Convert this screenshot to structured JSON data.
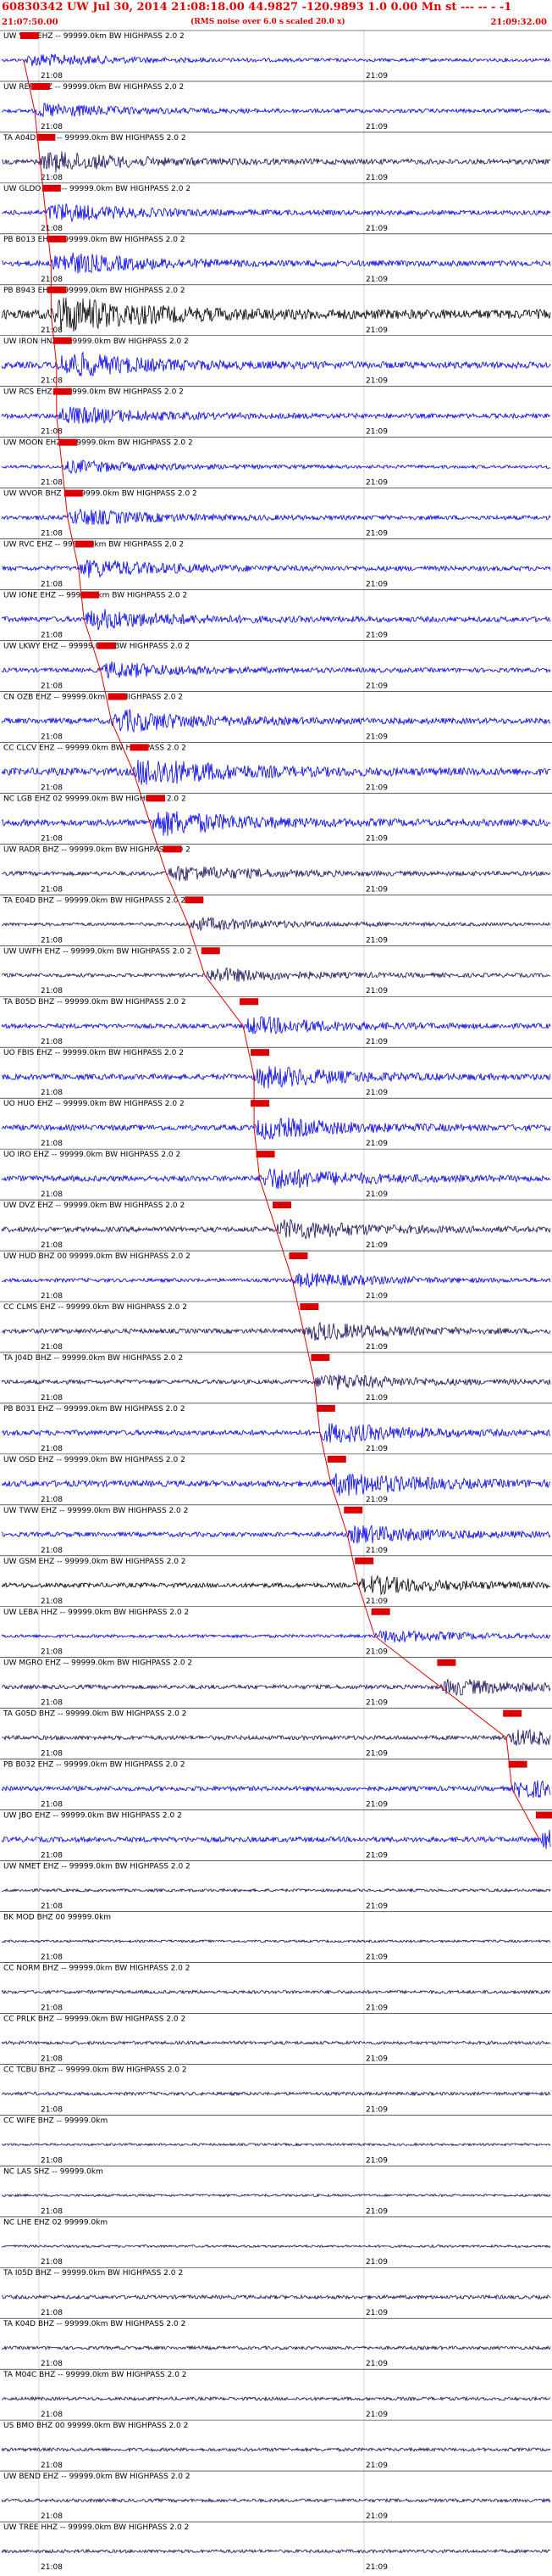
{
  "header": {
    "title": "60830342 UW Jul 30, 2014 21:08:18.00   44.9827 -120.9893  1.0 0.00 Mn st --- -- -   -1",
    "start_time": "21:07:50.00",
    "end_time": "21:09:32.00",
    "note": "(RMS noise over 6.0 s scaled 20.0 x)"
  },
  "colors": {
    "trace_a": "#0000ee",
    "trace_b": "#000000",
    "trace_c": "#1a0d5c",
    "pick": "#dd0000",
    "grid": "#000000",
    "label": "#000000"
  },
  "chart_data": {
    "type": "seismogram",
    "time_range": [
      "21:07:50.00",
      "21:09:32.00"
    ],
    "minute_ticks": [
      "21:08",
      "21:09"
    ],
    "traces": [
      {
        "label": "UW VCR EHZ -- 99999.0km BW  HIGHPASS  2.0  2",
        "color": "#0000ee",
        "amp": 0.35,
        "pick": 0.04
      },
      {
        "label": "UW RER EHZ -- 99999.0km BW  HIGHPASS  2.0  2",
        "color": "#0000ee",
        "amp": 0.4,
        "pick": 0.06
      },
      {
        "label": "TA A04D BHZ -- 99999.0km BW  HIGHPASS  2.0  2",
        "color": "#1a0d5c",
        "amp": 0.55,
        "pick": 0.07
      },
      {
        "label": "UW GLDO EHZ -- 99999.0km BW  HIGHPASS  2.0  2",
        "color": "#0000ee",
        "amp": 0.5,
        "pick": 0.08
      },
      {
        "label": "PB B013 EHZ -- 99999.0km BW  HIGHPASS  2.0  2",
        "color": "#0000ee",
        "amp": 0.6,
        "pick": 0.09
      },
      {
        "label": "PB B943 EHZ -- 99999.0km BW  HIGHPASS  2.0  2",
        "color": "#000000",
        "amp": 1.0,
        "pick": 0.09
      },
      {
        "label": "UW IRON HNZ -- 99999.0km BW  HIGHPASS  2.0  2",
        "color": "#0000ee",
        "amp": 0.7,
        "pick": 0.1
      },
      {
        "label": "UW RCS EHZ -- 99999.0km BW  HIGHPASS  2.0  2",
        "color": "#0000ee",
        "amp": 0.5,
        "pick": 0.1
      },
      {
        "label": "UW MOON EHZ -- 99999.0km BW  HIGHPASS  2.0  2",
        "color": "#0000ee",
        "amp": 0.35,
        "pick": 0.11
      },
      {
        "label": "UW WVOR BHZ 00 99999.0km BW  HIGHPASS  2.0  2",
        "color": "#0000ee",
        "amp": 0.45,
        "pick": 0.12
      },
      {
        "label": "UW RVC EHZ -- 99999.0km BW  HIGHPASS  2.0  2",
        "color": "#0000ee",
        "amp": 0.5,
        "pick": 0.14
      },
      {
        "label": "UW IONE EHZ -- 99999.0km BW  HIGHPASS  2.0  2",
        "color": "#0000ee",
        "amp": 0.55,
        "pick": 0.15
      },
      {
        "label": "UW LKWY EHZ -- 99999.0km BW  HIGHPASS  2.0  2",
        "color": "#0000ee",
        "amp": 0.45,
        "pick": 0.18
      },
      {
        "label": "CN OZB EHZ -- 99999.0km BW  HIGHPASS  2.0  2",
        "color": "#0000ee",
        "amp": 0.6,
        "pick": 0.2
      },
      {
        "label": "CC CLCV EHZ -- 99999.0km BW  HIGHPASS  2.0  2",
        "color": "#0000ee",
        "amp": 0.8,
        "pick": 0.24
      },
      {
        "label": "NC LGB EHZ 02 99999.0km BW  HIGHPASS  2.0  2",
        "color": "#0000ee",
        "amp": 0.7,
        "pick": 0.27
      },
      {
        "label": "UW RADR BHZ -- 99999.0km BW  HIGHPASS  2.0  2",
        "color": "#1a0d5c",
        "amp": 0.45,
        "pick": 0.3
      },
      {
        "label": "TA E04D BHZ -- 99999.0km BW  HIGHPASS  2.0  2",
        "color": "#1a0d5c",
        "amp": 0.35,
        "pick": 0.34
      },
      {
        "label": "UW UWFH EHZ -- 99999.0km BW  HIGHPASS  2.0  2",
        "color": "#1a0d5c",
        "amp": 0.4,
        "pick": 0.37
      },
      {
        "label": "TA B05D BHZ -- 99999.0km BW  HIGHPASS  2.0  2",
        "color": "#0000ee",
        "amp": 0.5,
        "pick": 0.44
      },
      {
        "label": "UO FBIS EHZ -- 99999.0km BW  HIGHPASS  2.0  2",
        "color": "#0000ee",
        "amp": 0.6,
        "pick": 0.46
      },
      {
        "label": "UO HUO EHZ -- 99999.0km BW  HIGHPASS  2.0  2",
        "color": "#0000ee",
        "amp": 0.6,
        "pick": 0.46
      },
      {
        "label": "UO IRO EHZ -- 99999.0km BW  HIGHPASS  2.0  2",
        "color": "#0000ee",
        "amp": 0.6,
        "pick": 0.47
      },
      {
        "label": "UW DVZ EHZ -- 99999.0km BW  HIGHPASS  2.0  2",
        "color": "#1a0d5c",
        "amp": 0.55,
        "pick": 0.5
      },
      {
        "label": "UW HUD BHZ 00 99999.0km BW  HIGHPASS  2.0  2",
        "color": "#0000ee",
        "amp": 0.4,
        "pick": 0.53
      },
      {
        "label": "CC CLMS EHZ -- 99999.0km BW  HIGHPASS  2.0  2",
        "color": "#1a0d5c",
        "amp": 0.5,
        "pick": 0.55
      },
      {
        "label": "TA J04D BHZ -- 99999.0km BW  HIGHPASS  2.0  2",
        "color": "#1a0d5c",
        "amp": 0.45,
        "pick": 0.57
      },
      {
        "label": "PB B031 EHZ -- 99999.0km BW  HIGHPASS  2.0  2",
        "color": "#0000ee",
        "amp": 0.55,
        "pick": 0.58
      },
      {
        "label": "UW OSD EHZ -- 99999.0km BW  HIGHPASS  2.0  2",
        "color": "#0000ee",
        "amp": 0.65,
        "pick": 0.6
      },
      {
        "label": "UW TWW EHZ -- 99999.0km BW  HIGHPASS  2.0  2",
        "color": "#0000ee",
        "amp": 0.5,
        "pick": 0.63
      },
      {
        "label": "UW GSM EHZ -- 99999.0km BW  HIGHPASS  2.0  2",
        "color": "#000000",
        "amp": 0.5,
        "pick": 0.65
      },
      {
        "label": "UW LEBA HHZ -- 99999.0km BW  HIGHPASS  2.0  2",
        "color": "#0000ee",
        "amp": 0.35,
        "pick": 0.68
      },
      {
        "label": "UW MGRO EHZ -- 99999.0km BW  HIGHPASS  2.0  2",
        "color": "#1a0d5c",
        "amp": 0.45,
        "pick": 0.8
      },
      {
        "label": "TA G05D BHZ -- 99999.0km BW  HIGHPASS  2.0  2",
        "color": "#1a0d5c",
        "amp": 0.45,
        "pick": 0.92
      },
      {
        "label": "PB B032 EHZ -- 99999.0km BW  HIGHPASS  2.0  2",
        "color": "#0000ee",
        "amp": 0.5,
        "pick": 0.93
      },
      {
        "label": "UW JBO EHZ -- 99999.0km BW  HIGHPASS  2.0  2",
        "color": "#0000ee",
        "amp": 0.55,
        "pick": 0.98
      },
      {
        "label": "UW NMET EHZ -- 99999.0km BW  HIGHPASS  2.0  2",
        "color": "#1a0d5c",
        "amp": 0.3,
        "pick": null
      },
      {
        "label": "BK MOD BHZ 00 99999.0km",
        "color": "#1a0d5c",
        "amp": 0.25,
        "pick": null
      },
      {
        "label": "CC NORM BHZ -- 99999.0km BW  HIGHPASS  2.0  2",
        "color": "#1a0d5c",
        "amp": 0.35,
        "pick": null
      },
      {
        "label": "CC PRLK BHZ -- 99999.0km BW  HIGHPASS  2.0  2",
        "color": "#1a0d5c",
        "amp": 0.35,
        "pick": null
      },
      {
        "label": "CC TCBU BHZ -- 99999.0km BW  HIGHPASS  2.0  2",
        "color": "#1a0d5c",
        "amp": 0.35,
        "pick": null
      },
      {
        "label": "CC WIFE BHZ -- 99999.0km",
        "color": "#1a0d5c",
        "amp": 0.25,
        "pick": null
      },
      {
        "label": "NC LAS SHZ -- 99999.0km",
        "color": "#1a0d5c",
        "amp": 0.25,
        "pick": null
      },
      {
        "label": "NC LHE EHZ 02 99999.0km",
        "color": "#1a0d5c",
        "amp": 0.25,
        "pick": null
      },
      {
        "label": "TA I05D BHZ -- 99999.0km BW  HIGHPASS  2.0  2",
        "color": "#1a0d5c",
        "amp": 0.4,
        "pick": null
      },
      {
        "label": "TA K04D BHZ -- 99999.0km BW  HIGHPASS  2.0  2",
        "color": "#1a0d5c",
        "amp": 0.35,
        "pick": null
      },
      {
        "label": "TA M04C BHZ -- 99999.0km BW  HIGHPASS  2.0  2",
        "color": "#1a0d5c",
        "amp": 0.35,
        "pick": null
      },
      {
        "label": "US BMO BHZ 00 99999.0km BW  HIGHPASS  2.0  2",
        "color": "#1a0d5c",
        "amp": 0.35,
        "pick": null
      },
      {
        "label": "UW BEND EHZ -- 99999.0km BW  HIGHPASS  2.0  2",
        "color": "#1a0d5c",
        "amp": 0.35,
        "pick": null
      },
      {
        "label": "UW TREE HHZ -- 99999.0km BW  HIGHPASS  2.0  2",
        "color": "#1a0d5c",
        "amp": 0.35,
        "pick": null
      }
    ]
  }
}
